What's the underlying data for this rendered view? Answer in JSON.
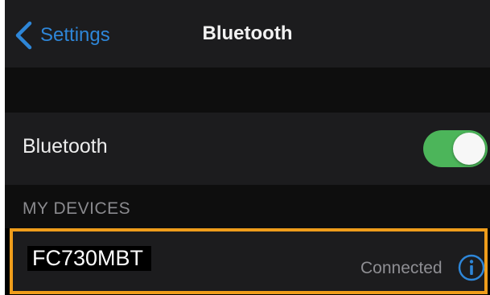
{
  "navbar": {
    "back_label": "Settings",
    "back_icon": "chevron-left-icon",
    "title": "Bluetooth"
  },
  "bluetooth_toggle": {
    "label": "Bluetooth",
    "state": "on",
    "on_color": "#4cb55a"
  },
  "section": {
    "header": "MY DEVICES"
  },
  "devices": [
    {
      "name": "FC730MBT",
      "status": "Connected",
      "info_icon": "info-icon",
      "highlight_color": "#ef9d1b"
    }
  ],
  "colors": {
    "accent": "#2e86d8",
    "background": "#000000",
    "cell_background": "#1c1c1e"
  }
}
